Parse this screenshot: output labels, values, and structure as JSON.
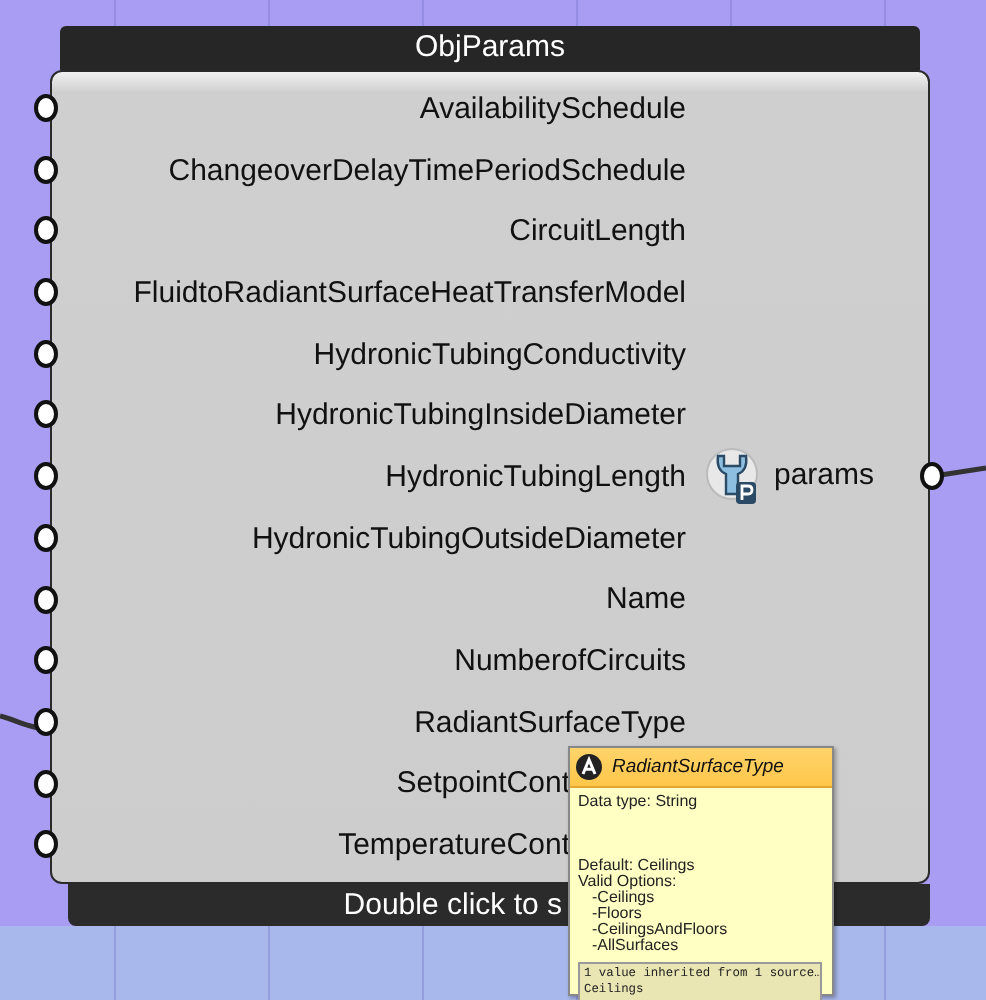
{
  "component": {
    "title": "ObjParams",
    "inputs": [
      {
        "label": "AvailabilitySchedule",
        "kind": "full"
      },
      {
        "label": "ChangeoverDelayTimePeriodSchedule",
        "kind": "full"
      },
      {
        "label": "CircuitLength",
        "kind": "full"
      },
      {
        "label": "FluidtoRadiantSurfaceHeatTransferModel",
        "kind": "full"
      },
      {
        "label": "HydronicTubingConductivity",
        "kind": "full"
      },
      {
        "label": "HydronicTubingInsideDiameter",
        "kind": "full"
      },
      {
        "label": "HydronicTubingLength",
        "kind": "full"
      },
      {
        "label": "HydronicTubingOutsideDiameter",
        "kind": "full"
      },
      {
        "label": "Name",
        "kind": "full"
      },
      {
        "label": "NumberofCircuits",
        "kind": "full"
      },
      {
        "label": "RadiantSurfaceType",
        "kind": "full"
      },
      {
        "label": "SetpointCont",
        "kind": "cut"
      },
      {
        "label": "TemperatureCont",
        "kind": "cut"
      }
    ],
    "output": "params",
    "footer": "Double click to s"
  },
  "tooltip": {
    "title": "RadiantSurfaceType",
    "data_type": "Data type: String",
    "default": "Default: Ceilings",
    "options_heading": "Valid Options:",
    "options": [
      "-Ceilings",
      "-Floors",
      "-CeilingsAndFloors",
      "-AllSurfaces"
    ],
    "inherited": "1 value inherited from 1 source…\nCeilings"
  }
}
